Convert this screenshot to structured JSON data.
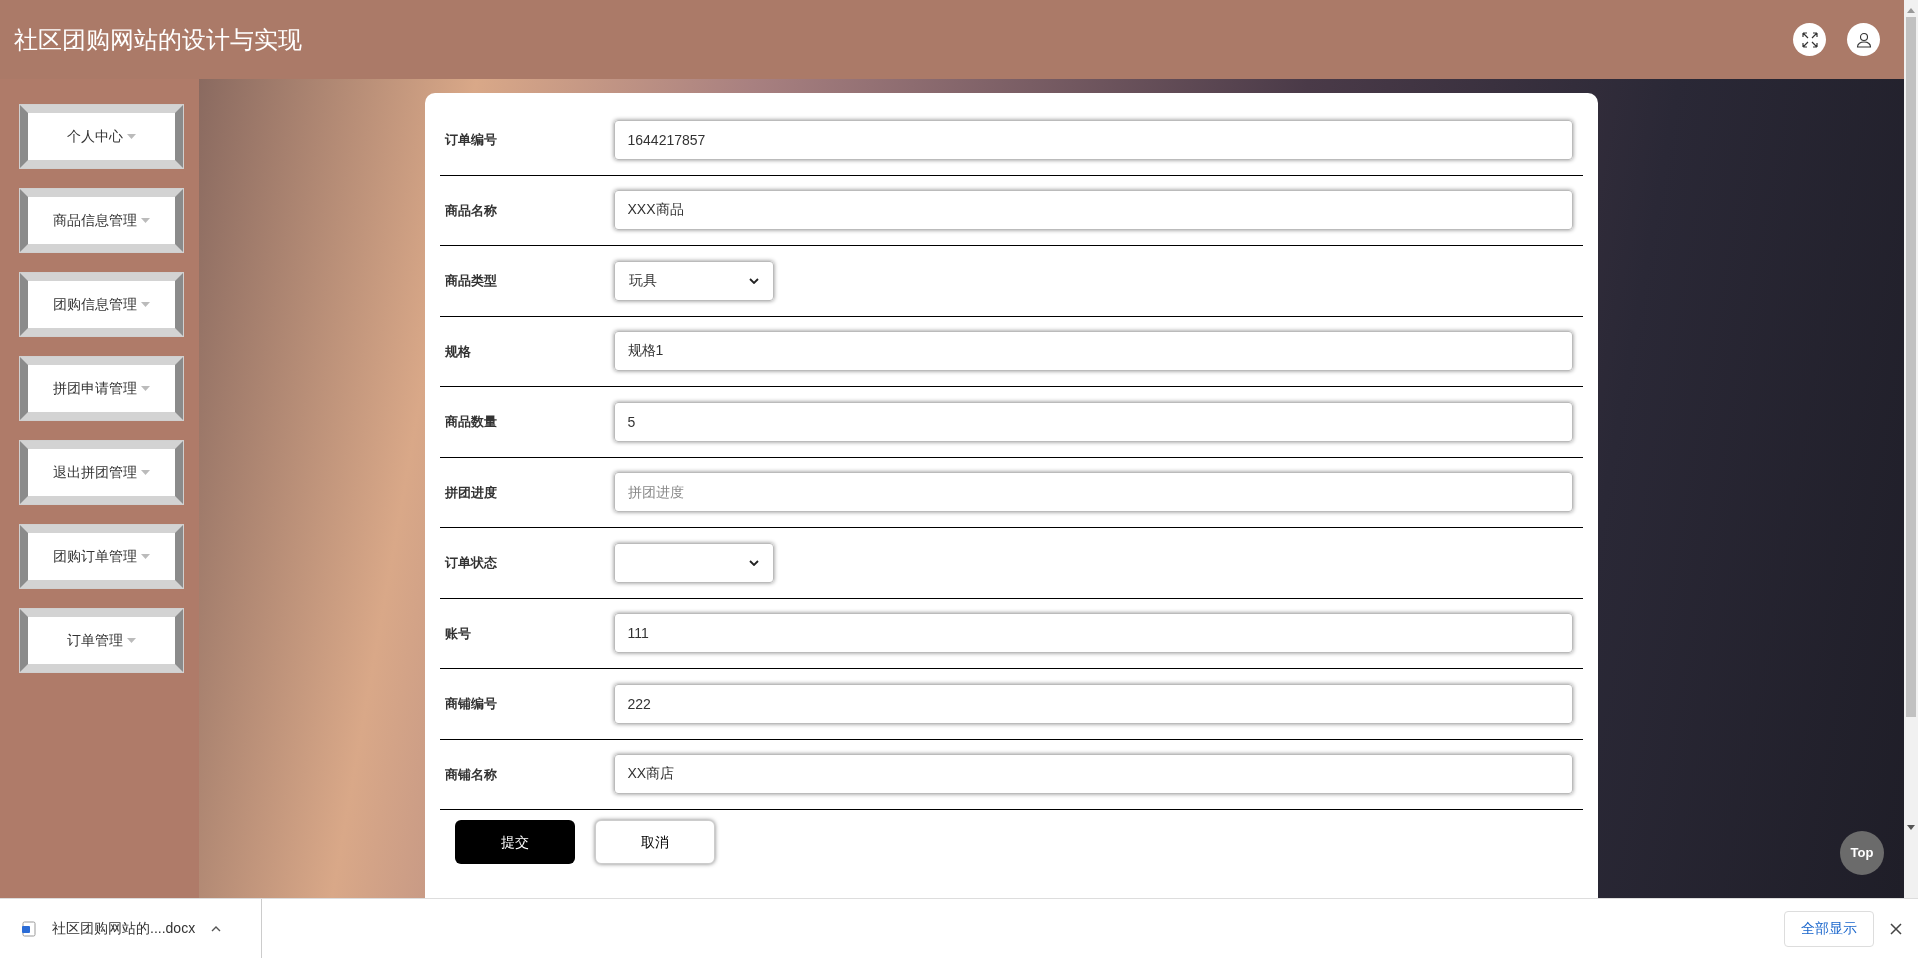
{
  "header": {
    "title": "社区团购网站的设计与实现"
  },
  "sidebar": {
    "items": [
      {
        "label": "个人中心"
      },
      {
        "label": "商品信息管理"
      },
      {
        "label": "团购信息管理"
      },
      {
        "label": "拼团申请管理"
      },
      {
        "label": "退出拼团管理"
      },
      {
        "label": "团购订单管理"
      },
      {
        "label": "订单管理"
      }
    ]
  },
  "form": {
    "fields": [
      {
        "kind": "text",
        "label": "订单编号",
        "value": "1644217857"
      },
      {
        "kind": "text",
        "label": "商品名称",
        "value": "XXX商品"
      },
      {
        "kind": "select",
        "label": "商品类型",
        "value": "玩具"
      },
      {
        "kind": "text",
        "label": "规格",
        "value": "规格1"
      },
      {
        "kind": "text",
        "label": "商品数量",
        "value": "5"
      },
      {
        "kind": "text",
        "label": "拼团进度",
        "placeholder": "拼团进度"
      },
      {
        "kind": "select",
        "label": "订单状态"
      },
      {
        "kind": "text",
        "label": "账号",
        "value": "111"
      },
      {
        "kind": "text",
        "label": "商铺编号",
        "value": "222"
      },
      {
        "kind": "text",
        "label": "商铺名称",
        "value": "XX商店"
      }
    ],
    "buttons": [
      {
        "kind": "primary",
        "label": "提交"
      },
      {
        "kind": "secondary",
        "label": "取消"
      }
    ]
  },
  "top_button": {
    "label": "Top"
  },
  "download_bar": {
    "file": "社区团购网站的....docx",
    "show_all": "全部显示"
  }
}
